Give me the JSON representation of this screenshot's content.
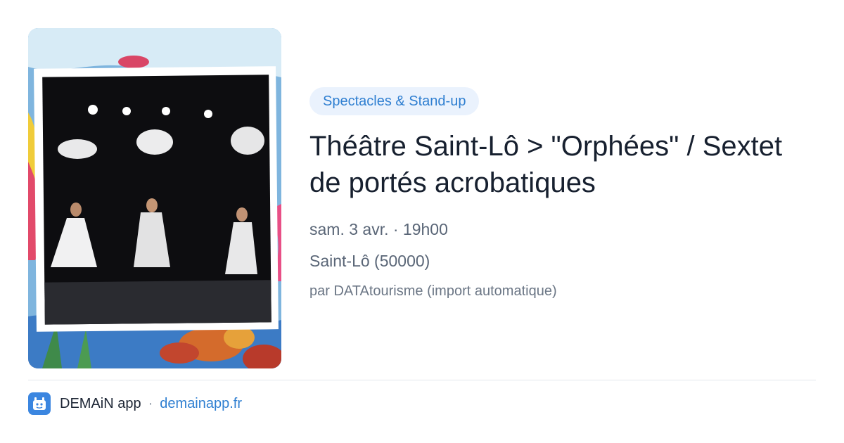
{
  "event": {
    "category": "Spectacles & Stand-up",
    "title": "Théâtre Saint-Lô > \"Orphées\" / Sextet de portés acrobatiques",
    "datetime": "sam. 3 avr. · 19h00",
    "location": "Saint-Lô (50000)",
    "source": "par DATAtourisme (import automatique)"
  },
  "footer": {
    "app_name": "DEMAiN app",
    "separator": "·",
    "url": "demainapp.fr"
  },
  "icons": {
    "app_logo": "demain-app-logo-icon"
  },
  "colors": {
    "accent": "#2f7fd1",
    "pill_bg": "#eaf2fd",
    "logo_bg": "#3b86e0"
  }
}
